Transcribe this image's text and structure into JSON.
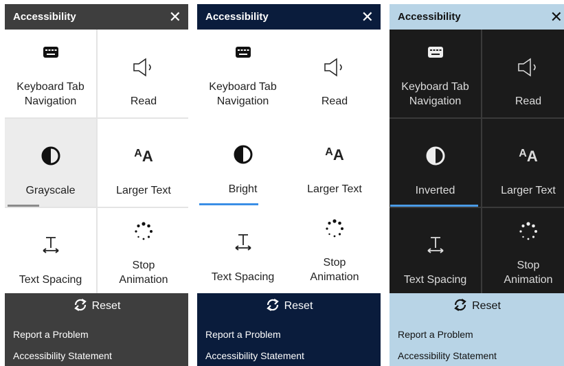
{
  "panels": [
    {
      "id": "panel-gray",
      "title": "Accessibility",
      "close": "✕",
      "items": [
        "Keyboard Tab Navigation",
        "Read",
        "Grayscale",
        "Larger Text",
        "Text Spacing",
        "Stop Animation"
      ],
      "reset": "Reset",
      "links": [
        "Report a Problem",
        "Accessibility Statement"
      ],
      "colors": {
        "header": "#3e3e3e",
        "accent": "#8a8a8a"
      }
    },
    {
      "id": "panel-blue",
      "title": "Accessibility",
      "close": "✕",
      "items": [
        "Keyboard Tab Navigation",
        "Read",
        "Bright",
        "Larger Text",
        "Text Spacing",
        "Stop Animation"
      ],
      "reset": "Reset",
      "links": [
        "Report a Problem",
        "Accessibility Statement"
      ],
      "colors": {
        "header": "#0a1c3c",
        "accent": "#3a8ee6"
      }
    },
    {
      "id": "panel-light",
      "title": "Accessibility",
      "close": "✕",
      "items": [
        "Keyboard Tab Navigation",
        "Read",
        "Inverted",
        "Larger Text",
        "Text Spacing",
        "Stop Animation"
      ],
      "reset": "Reset",
      "links": [
        "Report a Problem",
        "Accessibility Statement"
      ],
      "colors": {
        "header": "#b8d4e6",
        "accent": "#4a9be6"
      }
    }
  ],
  "labels": {
    "keyboard_line1": "Keyboard Tab",
    "keyboard_line2": "Navigation",
    "stop_line1": "Stop",
    "stop_line2": "Animation",
    "larger_text_icon_small": "A",
    "larger_text_icon_large": "A"
  },
  "icons": [
    "keyboard-icon",
    "speaker-icon",
    "contrast-icon",
    "text-size-icon",
    "text-spacing-icon",
    "loading-dots-icon",
    "refresh-icon",
    "close-icon"
  ]
}
